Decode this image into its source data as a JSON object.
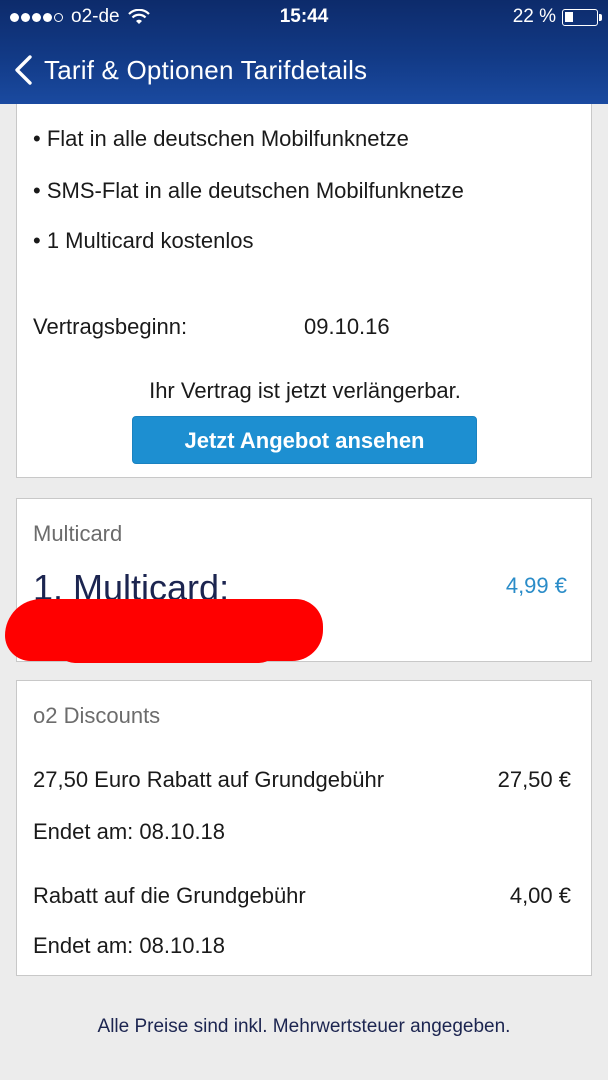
{
  "status_bar": {
    "carrier": "o2-de",
    "time": "15:44",
    "battery_percent": "22 %",
    "signal_dots": 5,
    "signal_filled": 4
  },
  "nav": {
    "back_label": "Tarif & Optionen",
    "title": "Tarifdetails",
    "full_title": "Tarif & Optionen Tarifdetails"
  },
  "tariff": {
    "features": [
      "• Flat in alle deutschen Mobilfunknetze",
      "• SMS-Flat in alle deutschen Mobilfunknetze",
      "• 1 Multicard kostenlos"
    ],
    "contract_start_label": "Vertragsbeginn:",
    "contract_start_value": "09.10.16",
    "renewal_text": "Ihr Vertrag ist jetzt verlängerbar.",
    "offer_button": "Jetzt Angebot ansehen"
  },
  "multicard": {
    "section_title": "Multicard",
    "item_name": "1. Multicard:",
    "price": "4,99 €"
  },
  "discounts": {
    "section_title": "o2 Discounts",
    "items": [
      {
        "label": "27,50 Euro Rabatt auf Grundgebühr",
        "amount": "27,50 €",
        "ends": "Endet am: 08.10.18"
      },
      {
        "label": "Rabatt auf die Grundgebühr",
        "amount": "4,00 €",
        "ends": "Endet am: 08.10.18"
      }
    ]
  },
  "footer_note": "Alle Preise sind inkl. Mehrwertsteuer angegeben.",
  "colors": {
    "header": "#123a86",
    "button": "#1d8fd1",
    "price": "#2a8cc8",
    "redaction": "#ff0000",
    "background": "#ececec"
  }
}
